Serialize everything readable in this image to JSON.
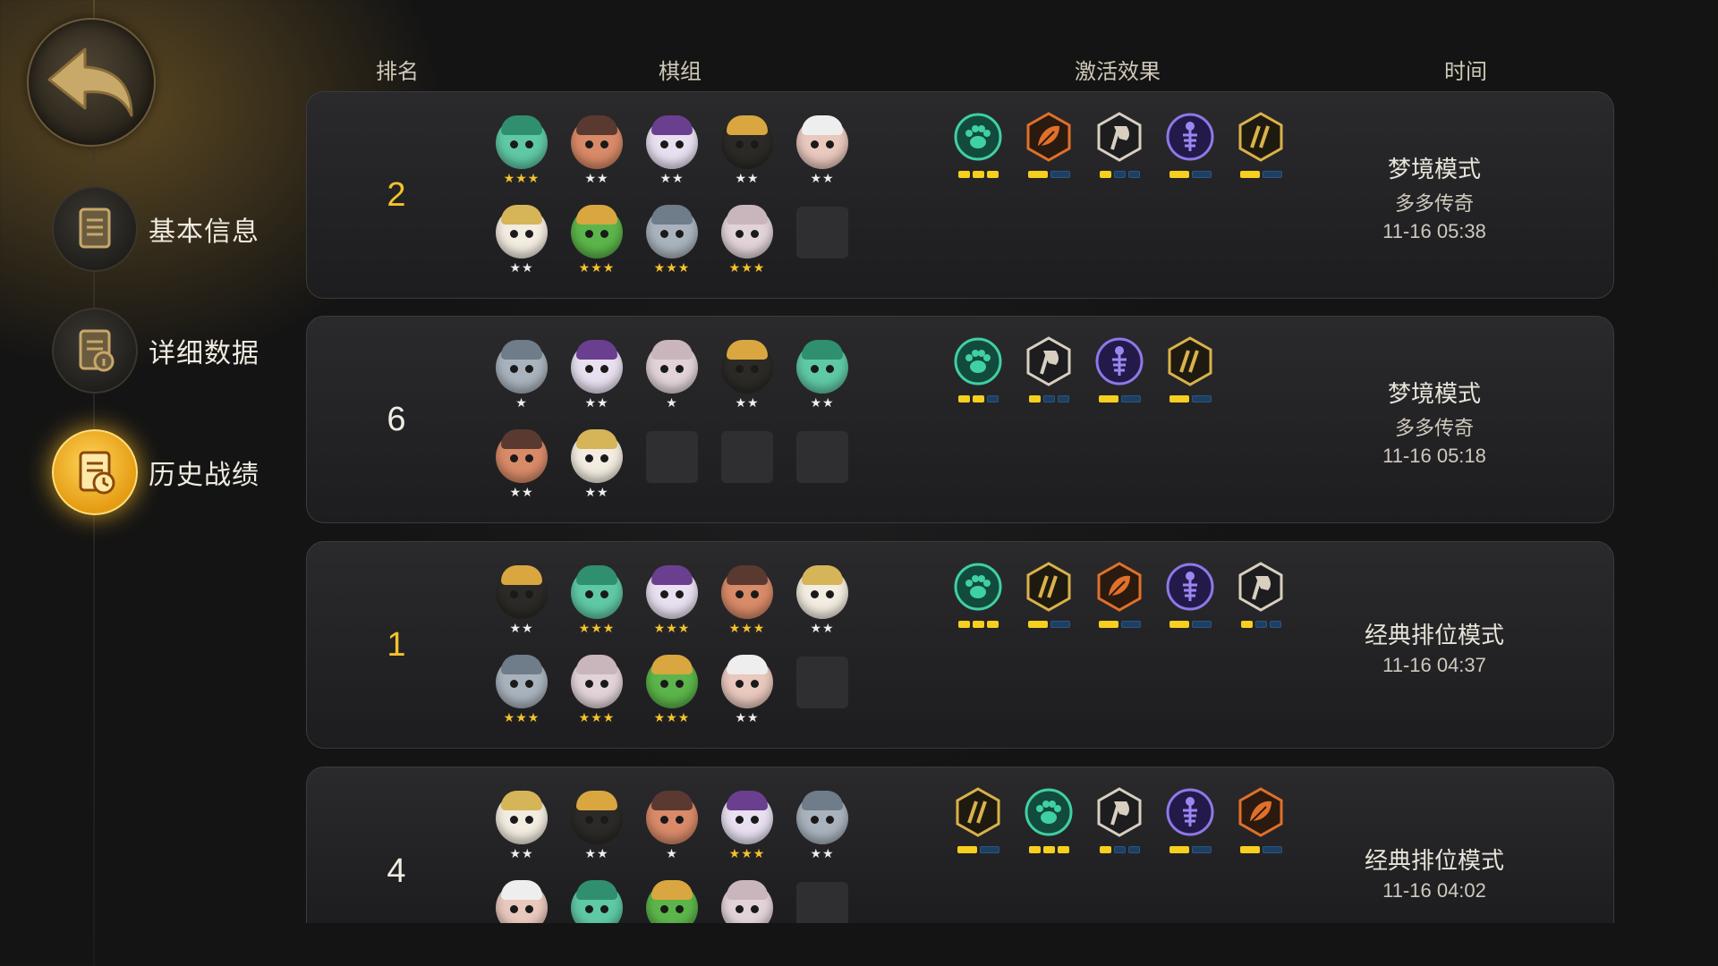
{
  "nav": {
    "items": [
      {
        "label": "基本信息",
        "icon": "document-icon",
        "active": false
      },
      {
        "label": "详细数据",
        "icon": "info-document-icon",
        "active": false
      },
      {
        "label": "历史战绩",
        "icon": "history-clock-icon",
        "active": true
      }
    ]
  },
  "headers": {
    "rank": "排名",
    "lineup": "棋组",
    "effects": "激活效果",
    "time": "时间"
  },
  "colors": {
    "gold": "#f4c22b",
    "pip_on": "#f7cf1e",
    "pip_off": "#1d3f63",
    "card_bg": "#222224"
  },
  "matches": [
    {
      "rank": "2",
      "rank_highlight": true,
      "mode": "梦境模式",
      "submode": "多多传奇",
      "time": "11-16 05:38",
      "pieces": [
        {
          "hero": "green-elf",
          "stars": "★★★",
          "gold": true
        },
        {
          "hero": "goggle-bear",
          "stars": "★★",
          "gold": false
        },
        {
          "hero": "hooded-mage",
          "stars": "★★",
          "gold": false
        },
        {
          "hero": "gold-hood",
          "stars": "★★",
          "gold": false
        },
        {
          "hero": "old-bearded",
          "stars": "★★",
          "gold": false
        },
        {
          "hero": "white-priest",
          "stars": "★★",
          "gold": false
        },
        {
          "hero": "green-goblin",
          "stars": "★★★",
          "gold": true
        },
        {
          "hero": "grey-beast",
          "stars": "★★★",
          "gold": true
        },
        {
          "hero": "pale-spirit",
          "stars": "★★★",
          "gold": true
        },
        {
          "hero": "",
          "stars": "",
          "gold": false
        }
      ],
      "effects": [
        {
          "icon": "paw-icon",
          "tiers": 3,
          "active": 3
        },
        {
          "icon": "leaf-icon",
          "tiers": 2,
          "active": 1
        },
        {
          "icon": "axe-icon",
          "tiers": 3,
          "active": 1
        },
        {
          "icon": "fishbone-icon",
          "tiers": 2,
          "active": 1
        },
        {
          "icon": "claw-icon",
          "tiers": 2,
          "active": 1
        }
      ]
    },
    {
      "rank": "6",
      "rank_highlight": false,
      "mode": "梦境模式",
      "submode": "多多传奇",
      "time": "11-16 05:18",
      "pieces": [
        {
          "hero": "grey-beast",
          "stars": "★",
          "gold": false
        },
        {
          "hero": "hooded-mage",
          "stars": "★★",
          "gold": false
        },
        {
          "hero": "pale-spirit",
          "stars": "★",
          "gold": false
        },
        {
          "hero": "gold-hood",
          "stars": "★★",
          "gold": false
        },
        {
          "hero": "green-elf",
          "stars": "★★",
          "gold": false
        },
        {
          "hero": "goggle-bear",
          "stars": "★★",
          "gold": false
        },
        {
          "hero": "white-priest",
          "stars": "★★",
          "gold": false
        },
        {
          "hero": "",
          "stars": "",
          "gold": false
        },
        {
          "hero": "",
          "stars": "",
          "gold": false
        },
        {
          "hero": "",
          "stars": "",
          "gold": false
        }
      ],
      "effects": [
        {
          "icon": "paw-icon",
          "tiers": 3,
          "active": 2
        },
        {
          "icon": "axe-icon",
          "tiers": 3,
          "active": 1
        },
        {
          "icon": "fishbone-icon",
          "tiers": 2,
          "active": 1
        },
        {
          "icon": "claw-icon",
          "tiers": 2,
          "active": 1
        }
      ]
    },
    {
      "rank": "1",
      "rank_highlight": true,
      "mode": "经典排位模式",
      "submode": "",
      "time": "11-16 04:37",
      "pieces": [
        {
          "hero": "gold-hood",
          "stars": "★★",
          "gold": false
        },
        {
          "hero": "green-elf",
          "stars": "★★★",
          "gold": true
        },
        {
          "hero": "hooded-mage",
          "stars": "★★★",
          "gold": true
        },
        {
          "hero": "goggle-bear",
          "stars": "★★★",
          "gold": true
        },
        {
          "hero": "white-priest",
          "stars": "★★",
          "gold": false
        },
        {
          "hero": "grey-beast",
          "stars": "★★★",
          "gold": true
        },
        {
          "hero": "pale-spirit",
          "stars": "★★★",
          "gold": true
        },
        {
          "hero": "green-goblin",
          "stars": "★★★",
          "gold": true
        },
        {
          "hero": "old-bearded",
          "stars": "★★",
          "gold": false
        },
        {
          "hero": "",
          "stars": "",
          "gold": false
        }
      ],
      "effects": [
        {
          "icon": "paw-icon",
          "tiers": 3,
          "active": 3
        },
        {
          "icon": "claw-icon",
          "tiers": 2,
          "active": 1
        },
        {
          "icon": "leaf-icon",
          "tiers": 2,
          "active": 1
        },
        {
          "icon": "fishbone-icon",
          "tiers": 2,
          "active": 1
        },
        {
          "icon": "axe-icon",
          "tiers": 3,
          "active": 1
        }
      ]
    },
    {
      "rank": "4",
      "rank_highlight": false,
      "mode": "经典排位模式",
      "submode": "",
      "time": "11-16 04:02",
      "pieces": [
        {
          "hero": "white-priest",
          "stars": "★★",
          "gold": false
        },
        {
          "hero": "gold-hood",
          "stars": "★★",
          "gold": false
        },
        {
          "hero": "goggle-bear",
          "stars": "★",
          "gold": false
        },
        {
          "hero": "hooded-mage",
          "stars": "★★★",
          "gold": true
        },
        {
          "hero": "grey-beast",
          "stars": "★★",
          "gold": false
        },
        {
          "hero": "old-bearded",
          "stars": "",
          "gold": false
        },
        {
          "hero": "green-elf",
          "stars": "",
          "gold": false
        },
        {
          "hero": "green-goblin",
          "stars": "",
          "gold": false
        },
        {
          "hero": "pale-spirit",
          "stars": "",
          "gold": false
        },
        {
          "hero": "",
          "stars": "",
          "gold": false
        }
      ],
      "effects": [
        {
          "icon": "claw-icon",
          "tiers": 2,
          "active": 1
        },
        {
          "icon": "paw-icon",
          "tiers": 3,
          "active": 3
        },
        {
          "icon": "axe-icon",
          "tiers": 3,
          "active": 1
        },
        {
          "icon": "fishbone-icon",
          "tiers": 2,
          "active": 1
        },
        {
          "icon": "leaf-icon",
          "tiers": 2,
          "active": 1
        }
      ]
    }
  ]
}
